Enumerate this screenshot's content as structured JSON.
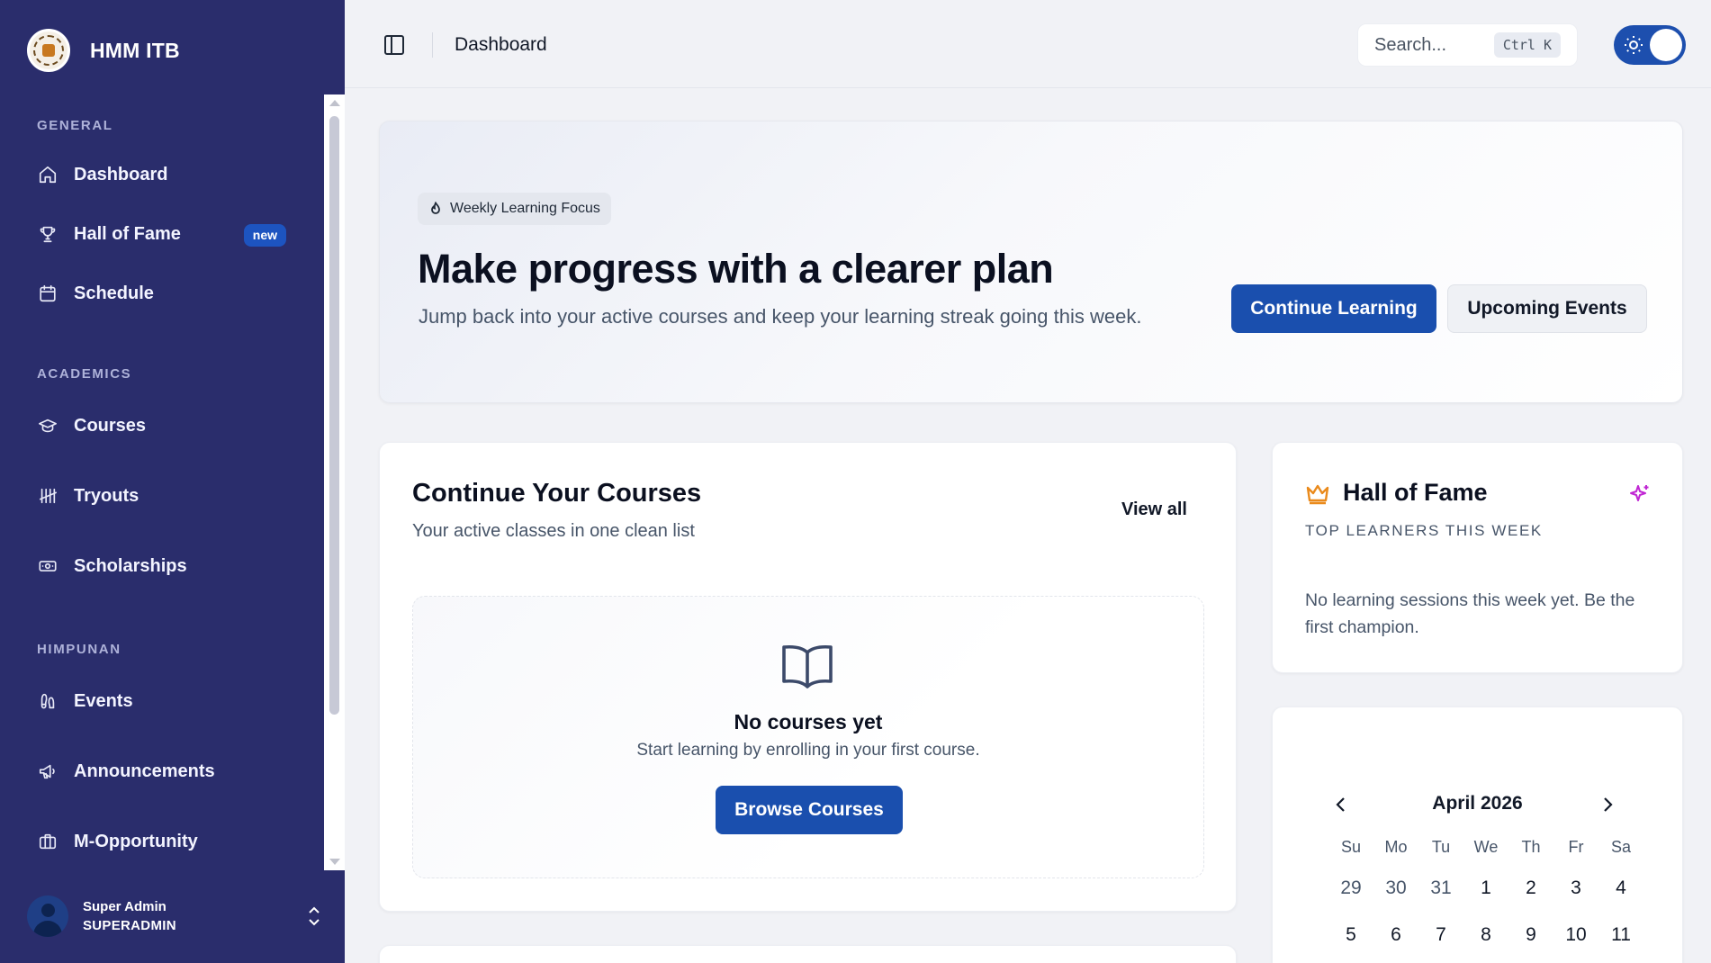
{
  "app": {
    "name": "HMM ITB"
  },
  "sidebar": {
    "sections": [
      {
        "label": "GENERAL"
      },
      {
        "label": "ACADEMICS"
      },
      {
        "label": "HIMPUNAN"
      }
    ],
    "items": [
      {
        "label": "Dashboard",
        "icon": "home-icon"
      },
      {
        "label": "Hall of Fame",
        "icon": "trophy-icon",
        "badge": "new"
      },
      {
        "label": "Schedule",
        "icon": "calendar-icon"
      },
      {
        "label": "Courses",
        "icon": "graduation-cap-icon"
      },
      {
        "label": "Tryouts",
        "icon": "tally-icon"
      },
      {
        "label": "Scholarships",
        "icon": "banknote-icon"
      },
      {
        "label": "Events",
        "icon": "footprints-icon"
      },
      {
        "label": "Announcements",
        "icon": "megaphone-icon"
      },
      {
        "label": "M-Opportunity",
        "icon": "briefcase-icon"
      }
    ],
    "user": {
      "name": "Super Admin",
      "role": "SUPERADMIN"
    }
  },
  "topbar": {
    "breadcrumb": "Dashboard",
    "search": {
      "placeholder": "Search...",
      "shortcut": "Ctrl K"
    },
    "theme": "light"
  },
  "hero": {
    "chip": "Weekly Learning Focus",
    "title": "Make progress with a clearer plan",
    "subtitle": "Jump back into your active courses and keep your learning streak going this week.",
    "primary_button": "Continue Learning",
    "secondary_button": "Upcoming Events"
  },
  "courses": {
    "title": "Continue Your Courses",
    "subtitle": "Your active classes in one clean list",
    "view_all": "View all",
    "empty_title": "No courses yet",
    "empty_subtitle": "Start learning by enrolling in your first course.",
    "browse_button": "Browse Courses"
  },
  "hall_of_fame": {
    "title": "Hall of Fame",
    "subtitle": "TOP LEARNERS THIS WEEK",
    "message": "No learning sessions this week yet. Be the first champion."
  },
  "calendar": {
    "month": "April 2026",
    "weekdays": [
      "Su",
      "Mo",
      "Tu",
      "We",
      "Th",
      "Fr",
      "Sa"
    ],
    "days": [
      "29",
      "30",
      "31",
      "1",
      "2",
      "3",
      "4",
      "5",
      "6",
      "7",
      "8",
      "9",
      "10",
      "11"
    ]
  },
  "colors": {
    "sidebar_bg": "#2a2d6c",
    "primary": "#1a4fae",
    "crown": "#ea8a1b",
    "sparkle": "#c026d3"
  }
}
